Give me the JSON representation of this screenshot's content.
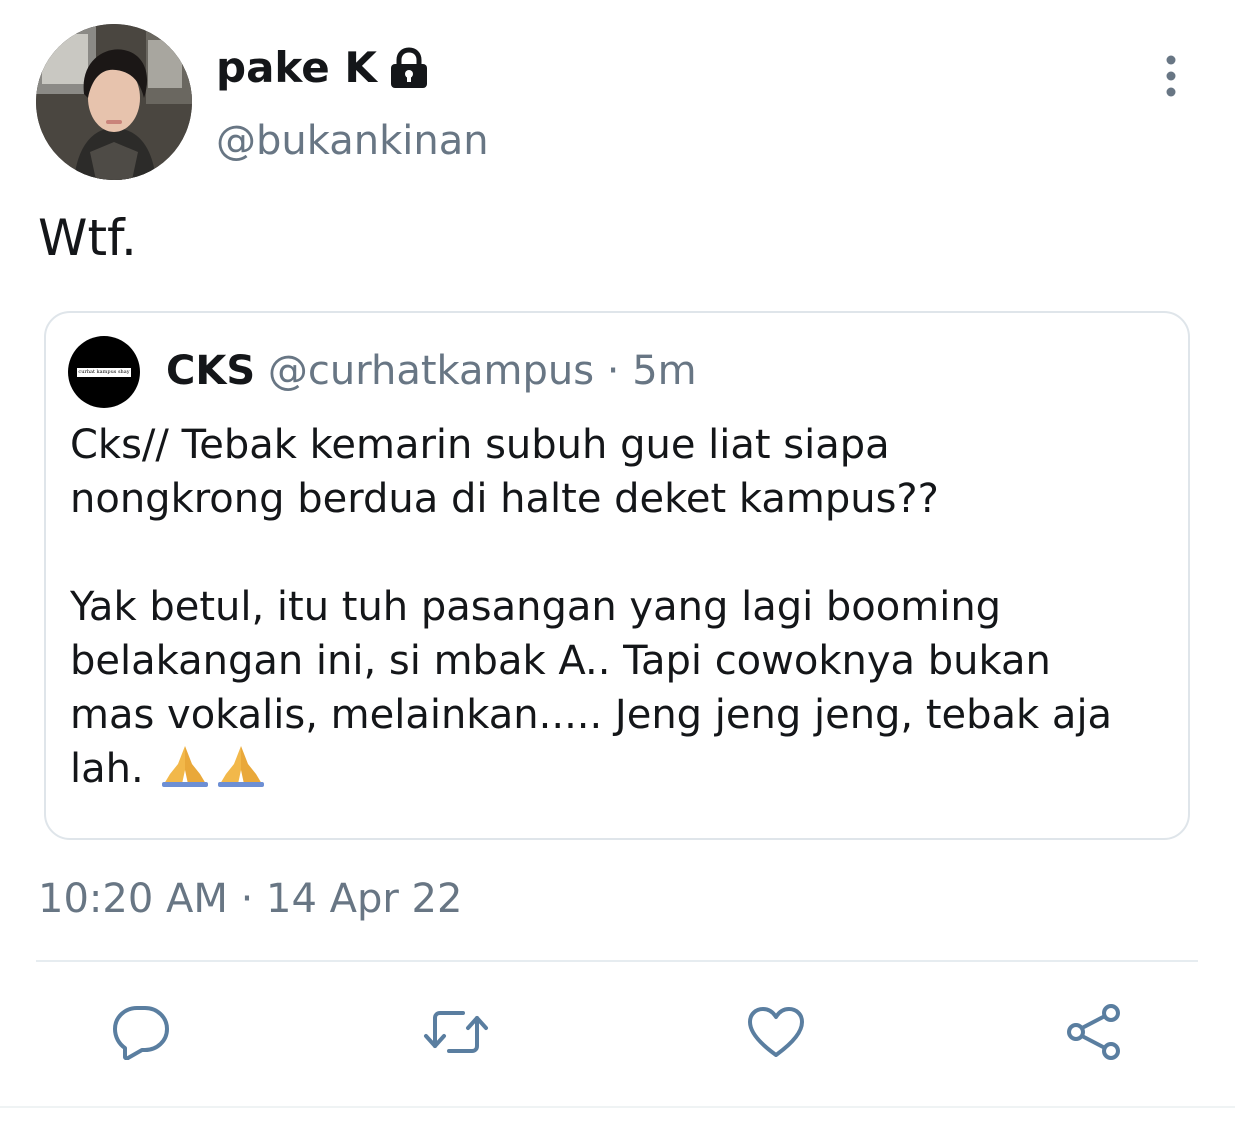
{
  "author": {
    "display_name": "pake K",
    "handle": "@bukankinan",
    "protected_icon": "lock-icon"
  },
  "tweet": {
    "text": "Wtf.",
    "timestamp": "10:20 AM · 14 Apr 22"
  },
  "quoted": {
    "avatar_text": "curhat kampus shay",
    "name": "CKS",
    "handle": "@curhatkampus",
    "separator": "·",
    "time": "5m",
    "lines": [
      "Cks// Tebak kemarin subuh gue liat siapa",
      "nongkrong berdua di halte deket kampus??",
      "",
      "Yak betul, itu tuh pasangan yang lagi booming",
      "belakangan ini, si mbak A.. Tapi cowoknya bukan",
      "mas vokalis, melainkan..... Jeng jeng jeng, tebak aja",
      "lah."
    ],
    "emoji": "🙏🙏"
  },
  "actions": {
    "reply_icon": "reply-icon",
    "retweet_icon": "retweet-icon",
    "like_icon": "heart-icon",
    "share_icon": "share-icon"
  },
  "colors": {
    "text_primary": "#141619",
    "text_secondary": "#687684",
    "icon_accent": "#5a7ea0",
    "border": "#dfe5ea"
  }
}
